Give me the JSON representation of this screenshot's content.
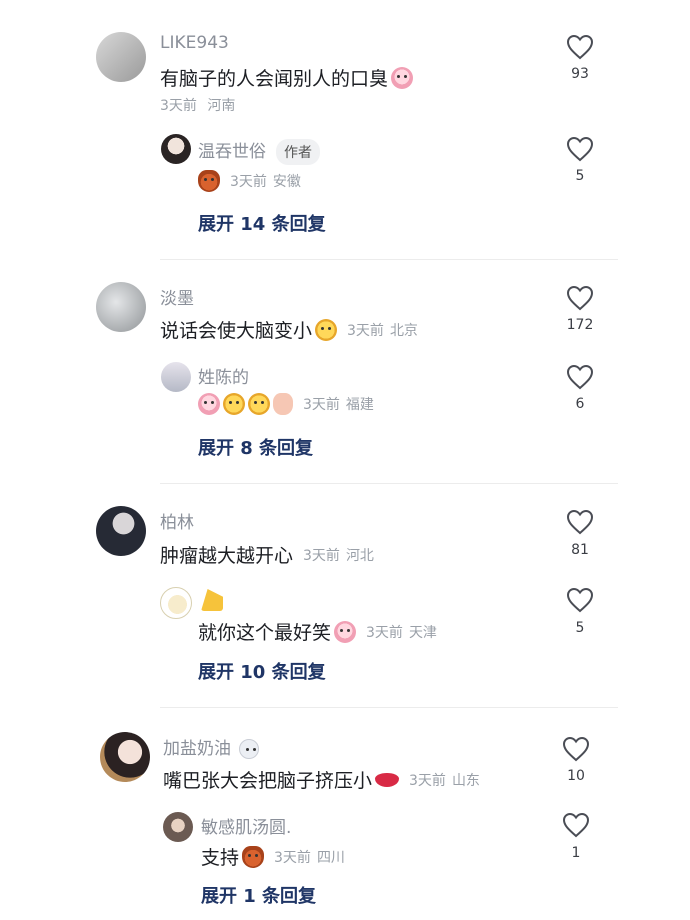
{
  "threads": [
    {
      "comment": {
        "user": "LIKE943",
        "text": "有脑子的人会闻别人的口臭",
        "emoji": [
          "cry"
        ],
        "time": "3天前",
        "location": "河南",
        "likes": "93"
      },
      "reply": {
        "user": "温吞世俗",
        "badge": "作者",
        "text": "",
        "emoji": [
          "devil"
        ],
        "time": "3天前",
        "location": "安徽",
        "likes": "5"
      },
      "expand": "展开 14 条回复"
    },
    {
      "comment": {
        "user": "淡墨",
        "text": "说话会使大脑变小",
        "emoji": [
          "smirk"
        ],
        "time": "3天前",
        "location": "北京",
        "likes": "172"
      },
      "reply": {
        "user": "姓陈的",
        "text": "",
        "emoji": [
          "cry",
          "smirk",
          "smirk",
          "thumb"
        ],
        "time": "3天前",
        "location": "福建",
        "likes": "6"
      },
      "expand": "展开 8 条回复"
    },
    {
      "comment": {
        "user": "柏林",
        "text": "肿瘤越大越开心",
        "emoji": [],
        "time": "3天前",
        "location": "河北",
        "likes": "81"
      },
      "reply": {
        "user": "",
        "text": "就你这个最好笑",
        "emoji": [
          "cry"
        ],
        "time": "3天前",
        "location": "天津",
        "likes": "5"
      },
      "expand": "展开 10 条回复"
    },
    {
      "comment": {
        "user": "加盐奶油",
        "text": "嘴巴张大会把脑子挤压小",
        "emoji": [
          "lips"
        ],
        "time": "3天前",
        "location": "山东",
        "likes": "10"
      },
      "reply": {
        "user": "敏感肌汤圆.",
        "text": "支持",
        "emoji": [
          "devil"
        ],
        "time": "3天前",
        "location": "四川",
        "likes": "1"
      },
      "expand": "展开 1 条回复"
    }
  ],
  "colors": {
    "name": "#8a8f99",
    "expand": "#1f3566",
    "meta": "#9aa0a8",
    "heart": "#3b3e45"
  }
}
